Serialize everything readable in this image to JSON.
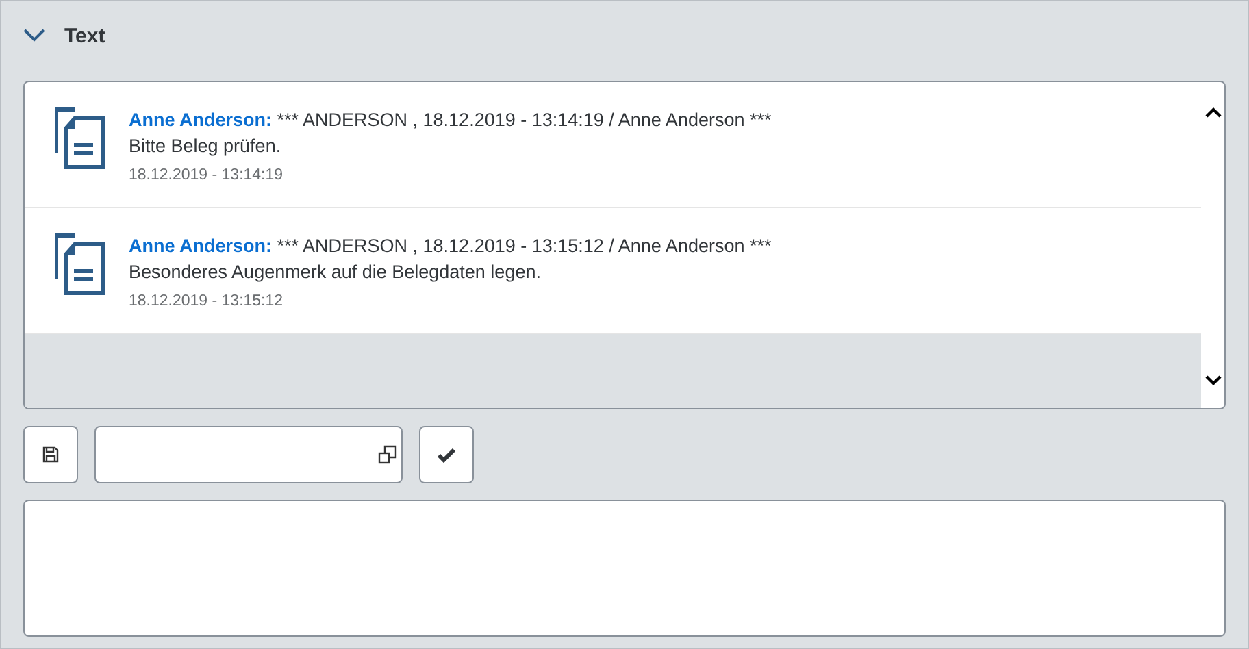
{
  "section": {
    "title": "Text",
    "expanded": true
  },
  "notes": [
    {
      "author": "Anne Anderson:",
      "header": "*** ANDERSON , 18.12.2019 - 13:14:19 / Anne Anderson ***",
      "text": "Bitte Beleg prüfen.",
      "timestamp": "18.12.2019 - 13:14:19"
    },
    {
      "author": "Anne Anderson:",
      "header": "*** ANDERSON , 18.12.2019 - 13:15:12 / Anne Anderson ***",
      "text": "Besonderes Augenmerk auf die Belegdaten legen.",
      "timestamp": "18.12.2019 - 13:15:12"
    }
  ]
}
